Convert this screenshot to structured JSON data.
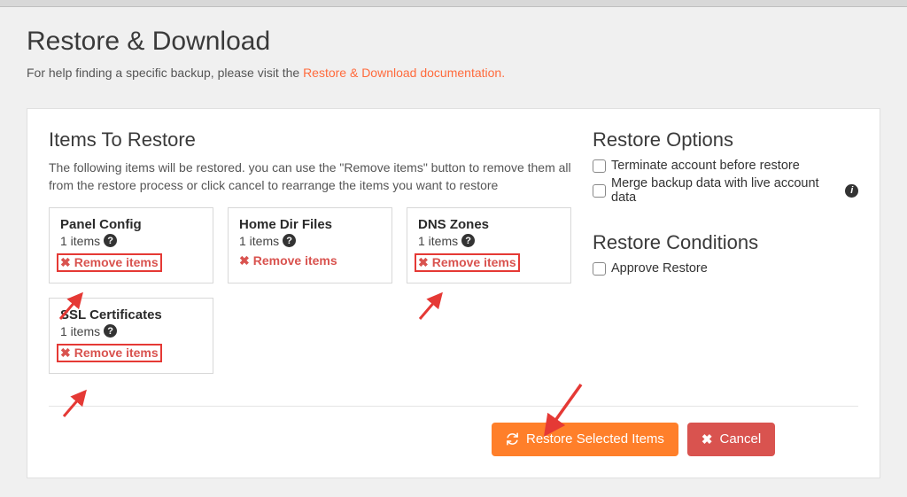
{
  "page": {
    "title": "Restore & Download",
    "subtitle_prefix": "For help finding a specific backup, please visit the ",
    "doc_link_text": "Restore & Download documentation."
  },
  "items_section": {
    "title": "Items To Restore",
    "description": "The following items will be restored. you can use the \"Remove items\" button to remove them all from the restore process or click cancel to rearrange the items you want to restore",
    "remove_label": "Remove items",
    "cards": [
      {
        "title": "Panel Config",
        "count_text": "1 items",
        "highlighted": true
      },
      {
        "title": "Home Dir Files",
        "count_text": "1 items",
        "highlighted": false
      },
      {
        "title": "DNS Zones",
        "count_text": "1 items",
        "highlighted": true
      },
      {
        "title": "SSL Certificates",
        "count_text": "1 items",
        "highlighted": true
      }
    ]
  },
  "restore_options": {
    "title": "Restore Options",
    "options": [
      {
        "label": "Terminate account before restore",
        "has_info": false
      },
      {
        "label": "Merge backup data with live account data",
        "has_info": true
      }
    ]
  },
  "restore_conditions": {
    "title": "Restore Conditions",
    "options": [
      {
        "label": "Approve Restore"
      }
    ]
  },
  "actions": {
    "restore": "Restore Selected Items",
    "cancel": "Cancel"
  }
}
